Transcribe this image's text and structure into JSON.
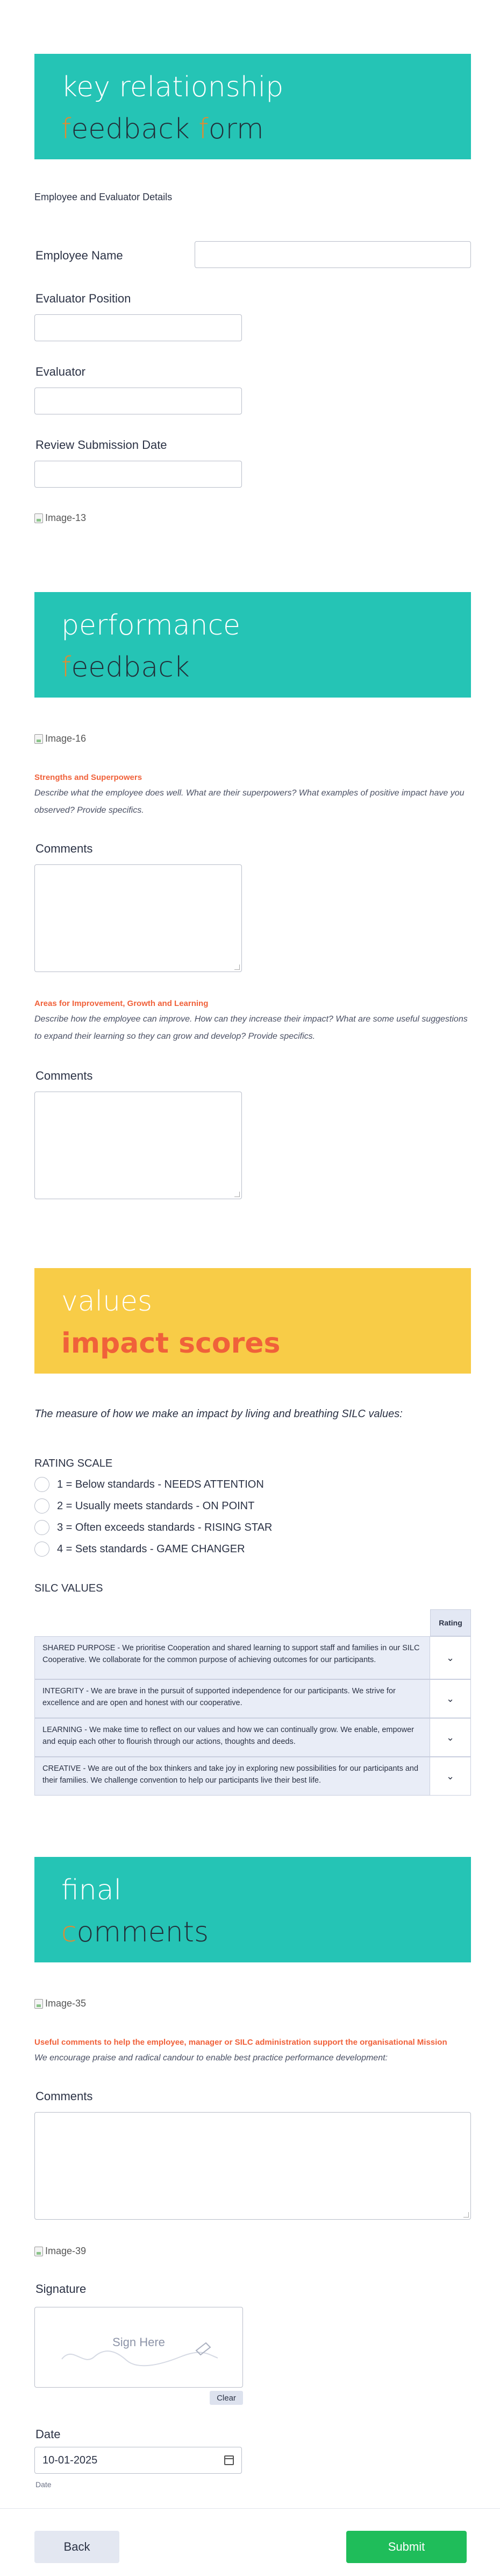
{
  "header": {
    "line1": "key relationship",
    "line2_accent1": "f",
    "line2_mid": "eedback ",
    "line2_accent2": "f",
    "line2_rest": "orm"
  },
  "intro": "Employee and Evaluator Details",
  "fields": {
    "employee_name": "Employee Name",
    "evaluator_position": "Evaluator Position",
    "evaluator": "Evaluator",
    "review_date": "Review Submission Date"
  },
  "images": {
    "img13": "Image-13",
    "img16": "Image-16",
    "img35": "Image-35",
    "img39": "Image-39"
  },
  "performance": {
    "line1": "performance",
    "accent": "f",
    "rest": "eedback"
  },
  "strengths": {
    "title": "Strengths and Superpowers",
    "desc": "Describe what the employee does well. What are their superpowers? What examples of positive impact have you observed? Provide specifics.",
    "comments_label": "Comments"
  },
  "improvement": {
    "title": "Areas for Improvement, Growth and Learning",
    "desc": "Describe how the employee can improve. How can they increase their impact? What are some useful suggestions to expand their learning so they can grow and develop? Provide specifics.",
    "comments_label": "Comments"
  },
  "values": {
    "line1": "values",
    "line2": "impact scores"
  },
  "values_intro": "The measure of how we make an impact by living and breathing SILC values:",
  "rating_scale": {
    "label": "RATING SCALE",
    "options": [
      "1 = Below standards - NEEDS ATTENTION",
      "2 = Usually meets standards - ON POINT",
      "3 = Often exceeds standards - RISING STAR",
      "4 = Sets standards - GAME CHANGER"
    ]
  },
  "silc": {
    "label": "SILC VALUES",
    "rating_header": "Rating",
    "rows": [
      "SHARED PURPOSE - We prioritise Cooperation and shared learning to support staff and families in our SILC Cooperative. We collaborate for the common purpose of achieving outcomes for our participants.",
      "INTEGRITY - We are brave in the pursuit of supported independence for our participants. We strive for excellence and are open and honest with our cooperative.",
      "LEARNING - We make time to reflect on our values and how we can continually grow. We enable, empower and equip each other to flourish through our actions, thoughts and deeds.",
      "CREATIVE - We are out of the box thinkers and take joy in exploring new possibilities for our participants and their families. We challenge convention to help our participants live their best life."
    ],
    "select_icon": "chevron-down"
  },
  "final": {
    "line1": "final",
    "accent": "c",
    "rest": "omments"
  },
  "useful": {
    "title": "Useful comments to help the employee, manager or SILC administration support the organisational Mission",
    "desc": "We encourage praise and radical candour to enable best practice performance development:",
    "comments_label": "Comments"
  },
  "signature": {
    "label": "Signature",
    "placeholder": "Sign Here",
    "clear": "Clear"
  },
  "date": {
    "label": "Date",
    "value": "10-01-2025",
    "sublabel": "Date"
  },
  "buttons": {
    "back": "Back",
    "submit": "Submit"
  },
  "colors": {
    "teal": "#25c4b5",
    "yellow": "#f8cc47",
    "orange_accent": "#e58a2e",
    "red_accent": "#f0613a",
    "submit_green": "#1fbd5a"
  }
}
